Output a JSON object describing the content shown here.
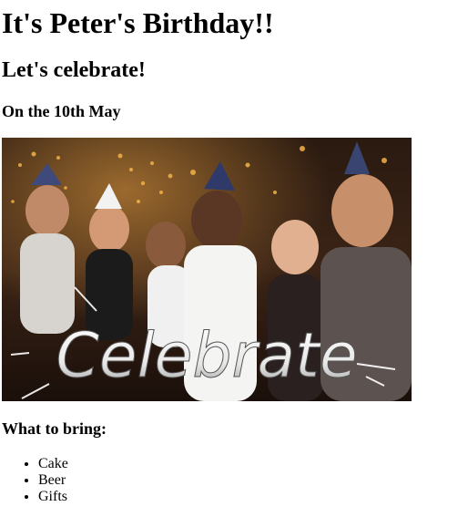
{
  "page": {
    "title": "It's Peter's Birthday!!",
    "subtitle": "Let's celebrate!",
    "date_line": "On the 10th May",
    "image": {
      "overlay_text": "Celebrate",
      "icon": "party-photo-icon"
    },
    "bring_heading": "What to bring:",
    "bring_items": [
      "Cake",
      "Beer",
      "Gifts"
    ]
  },
  "colors": {
    "text": "#000000",
    "background": "#ffffff"
  }
}
